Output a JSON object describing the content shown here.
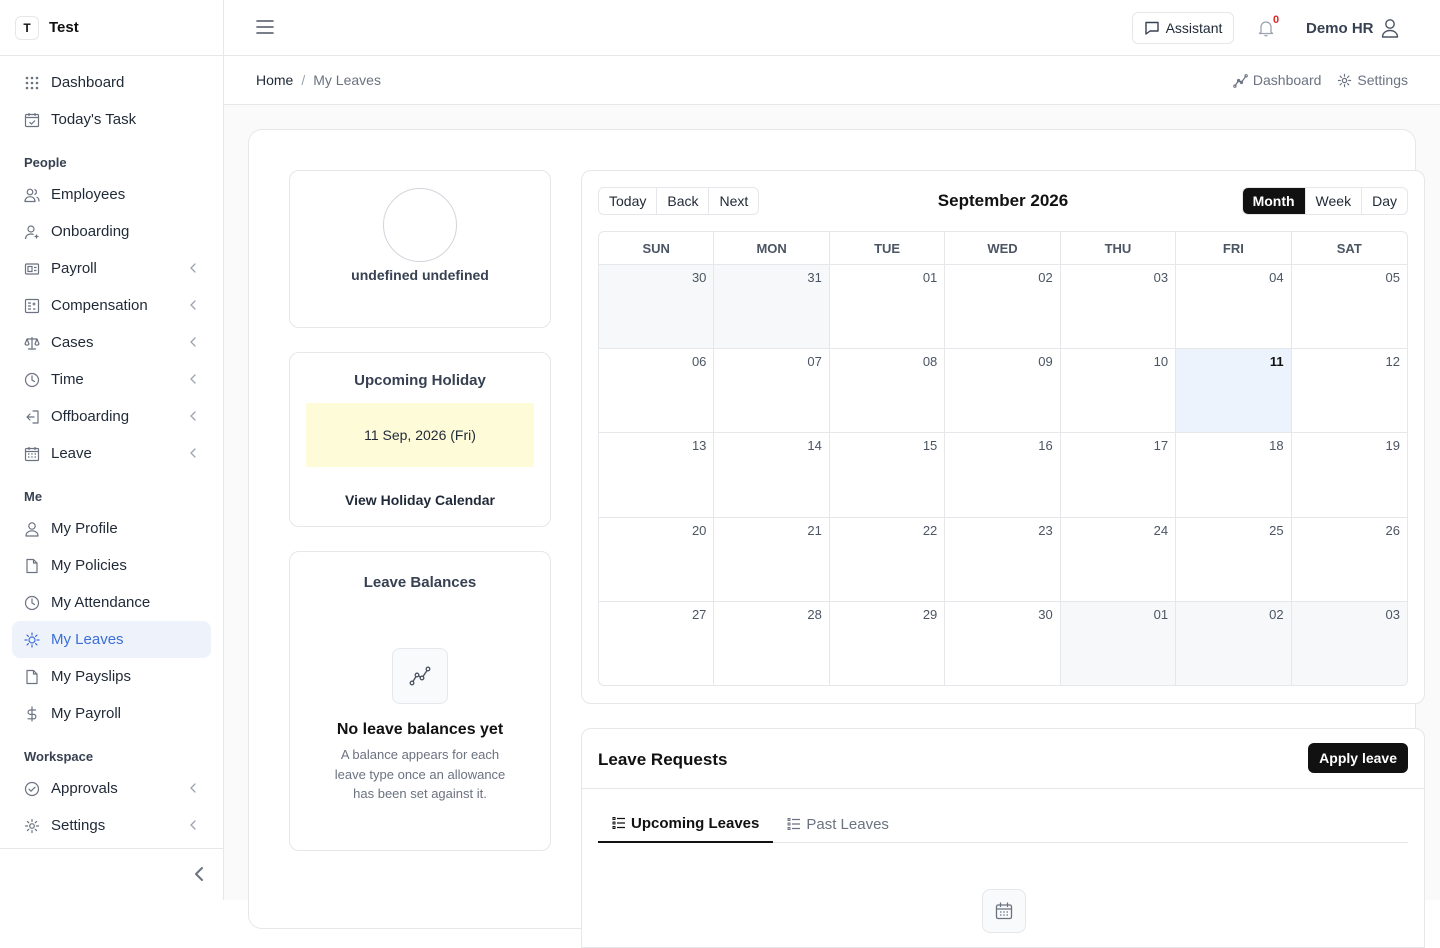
{
  "brand": {
    "initial": "T",
    "name": "Test"
  },
  "sidebar": {
    "top": [
      {
        "label": "Dashboard",
        "icon": "grid-icon"
      },
      {
        "label": "Today's Task",
        "icon": "calendar-check-icon"
      }
    ],
    "people_heading": "People",
    "people": [
      {
        "label": "Employees",
        "icon": "users-icon",
        "expandable": false
      },
      {
        "label": "Onboarding",
        "icon": "user-plus-icon",
        "expandable": false
      },
      {
        "label": "Payroll",
        "icon": "payroll-icon",
        "expandable": true
      },
      {
        "label": "Compensation",
        "icon": "compensation-icon",
        "expandable": true
      },
      {
        "label": "Cases",
        "icon": "scale-icon",
        "expandable": true
      },
      {
        "label": "Time",
        "icon": "clock-icon",
        "expandable": true
      },
      {
        "label": "Offboarding",
        "icon": "log-out-icon",
        "expandable": true
      },
      {
        "label": "Leave",
        "icon": "calendar-icon",
        "expandable": true
      }
    ],
    "me_heading": "Me",
    "me": [
      {
        "label": "My Profile",
        "icon": "user-icon"
      },
      {
        "label": "My Policies",
        "icon": "file-icon"
      },
      {
        "label": "My Attendance",
        "icon": "clock-icon"
      },
      {
        "label": "My Leaves",
        "icon": "sun-icon",
        "active": true
      },
      {
        "label": "My Payslips",
        "icon": "file-icon"
      },
      {
        "label": "My Payroll",
        "icon": "dollar-icon"
      }
    ],
    "workspace_heading": "Workspace",
    "workspace": [
      {
        "label": "Approvals",
        "icon": "check-circle-icon",
        "expandable": true
      },
      {
        "label": "Settings",
        "icon": "gear-icon",
        "expandable": true
      }
    ]
  },
  "header": {
    "assistant_label": "Assistant",
    "notification_count": "0",
    "user_name": "Demo HR"
  },
  "breadcrumb": {
    "home": "Home",
    "separator": "/",
    "current": "My Leaves"
  },
  "quick_links": {
    "dashboard": "Dashboard",
    "settings": "Settings"
  },
  "profile": {
    "name": "undefined undefined"
  },
  "holiday": {
    "title": "Upcoming Holiday",
    "date": "11 Sep, 2026 (Fri)",
    "link": "View Holiday Calendar",
    "highlight_color": "#fefbd8"
  },
  "balances": {
    "title": "Leave Balances",
    "empty_title": "No leave balances yet",
    "empty_text": "A balance appears for each leave type once an allowance has been set against it."
  },
  "calendar": {
    "nav_buttons": [
      "Today",
      "Back",
      "Next"
    ],
    "title": "September 2026",
    "views": [
      "Month",
      "Week",
      "Day"
    ],
    "active_view": "Month",
    "weekdays": [
      "SUN",
      "MON",
      "TUE",
      "WED",
      "THU",
      "FRI",
      "SAT"
    ],
    "days": [
      {
        "d": "30",
        "off": true
      },
      {
        "d": "31",
        "off": true
      },
      {
        "d": "01"
      },
      {
        "d": "02"
      },
      {
        "d": "03"
      },
      {
        "d": "04"
      },
      {
        "d": "05"
      },
      {
        "d": "06"
      },
      {
        "d": "07"
      },
      {
        "d": "08"
      },
      {
        "d": "09"
      },
      {
        "d": "10"
      },
      {
        "d": "11",
        "today": true
      },
      {
        "d": "12"
      },
      {
        "d": "13"
      },
      {
        "d": "14"
      },
      {
        "d": "15"
      },
      {
        "d": "16"
      },
      {
        "d": "17"
      },
      {
        "d": "18"
      },
      {
        "d": "19"
      },
      {
        "d": "20"
      },
      {
        "d": "21"
      },
      {
        "d": "22"
      },
      {
        "d": "23"
      },
      {
        "d": "24"
      },
      {
        "d": "25"
      },
      {
        "d": "26"
      },
      {
        "d": "27"
      },
      {
        "d": "28"
      },
      {
        "d": "29"
      },
      {
        "d": "30"
      },
      {
        "d": "01",
        "off": true
      },
      {
        "d": "02",
        "off": true
      },
      {
        "d": "03",
        "off": true
      }
    ]
  },
  "requests": {
    "title": "Leave Requests",
    "apply_label": "Apply leave",
    "tabs": [
      {
        "label": "Upcoming Leaves",
        "active": true
      },
      {
        "label": "Past Leaves",
        "active": false
      }
    ]
  },
  "colors": {
    "accent": "#3b6fd6",
    "today_bg": "#edf3fd",
    "primary_button": "#111111",
    "notification": "#dc2626"
  }
}
